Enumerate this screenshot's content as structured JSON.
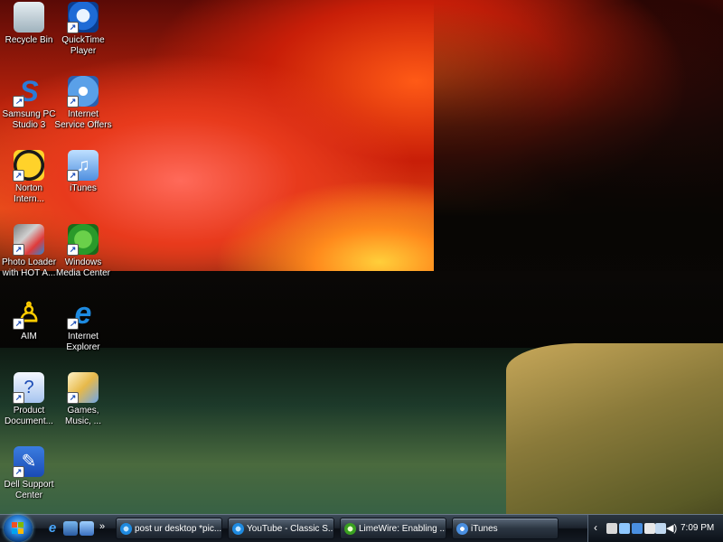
{
  "desktop": {
    "icons": [
      {
        "label": "Recycle Bin",
        "icon": "recycle-bin-icon",
        "shortcut": false
      },
      {
        "label": "QuickTime Player",
        "icon": "quicktime-icon",
        "shortcut": true
      },
      {
        "label": "Samsung PC Studio 3",
        "icon": "samsung-pc-studio-icon",
        "shortcut": true
      },
      {
        "label": "Internet Service Offers",
        "icon": "internet-service-offers-icon",
        "shortcut": true
      },
      {
        "label": "Norton Intern...",
        "icon": "norton-icon",
        "shortcut": true
      },
      {
        "label": "iTunes",
        "icon": "itunes-icon",
        "shortcut": true
      },
      {
        "label": "Photo Loader with HOT A...",
        "icon": "photo-loader-icon",
        "shortcut": true
      },
      {
        "label": "Windows Media Center",
        "icon": "windows-media-center-icon",
        "shortcut": true
      },
      {
        "label": "AIM",
        "icon": "aim-icon",
        "shortcut": true
      },
      {
        "label": "Internet Explorer",
        "icon": "internet-explorer-icon",
        "shortcut": true
      },
      {
        "label": "Product Document...",
        "icon": "product-documentation-icon",
        "shortcut": true
      },
      {
        "label": "Games, Music, ...",
        "icon": "games-music-icon",
        "shortcut": true
      },
      {
        "label": "Dell Support Center",
        "icon": "dell-support-icon",
        "shortcut": true
      }
    ]
  },
  "taskbar": {
    "start_icon": "windows-start-orb-icon",
    "quick_launch": [
      {
        "icon": "internet-explorer-icon"
      },
      {
        "icon": "show-desktop-icon"
      },
      {
        "icon": "switch-windows-icon"
      }
    ],
    "quick_launch_more": "»",
    "tasks": [
      {
        "label": "post ur desktop *pic...",
        "icon": "internet-explorer-icon"
      },
      {
        "label": "YouTube - Classic S...",
        "icon": "internet-explorer-icon"
      },
      {
        "label": "LimeWire: Enabling ...",
        "icon": "limewire-icon"
      },
      {
        "label": "iTunes",
        "icon": "itunes-icon"
      }
    ],
    "tray": {
      "chevron": "‹",
      "volume_icon": "volume-icon",
      "volume_glyph": "◀)",
      "clock": "7:09 PM"
    }
  },
  "colors": {
    "taskbar": "#1b222c",
    "label_text": "#ffffff"
  }
}
